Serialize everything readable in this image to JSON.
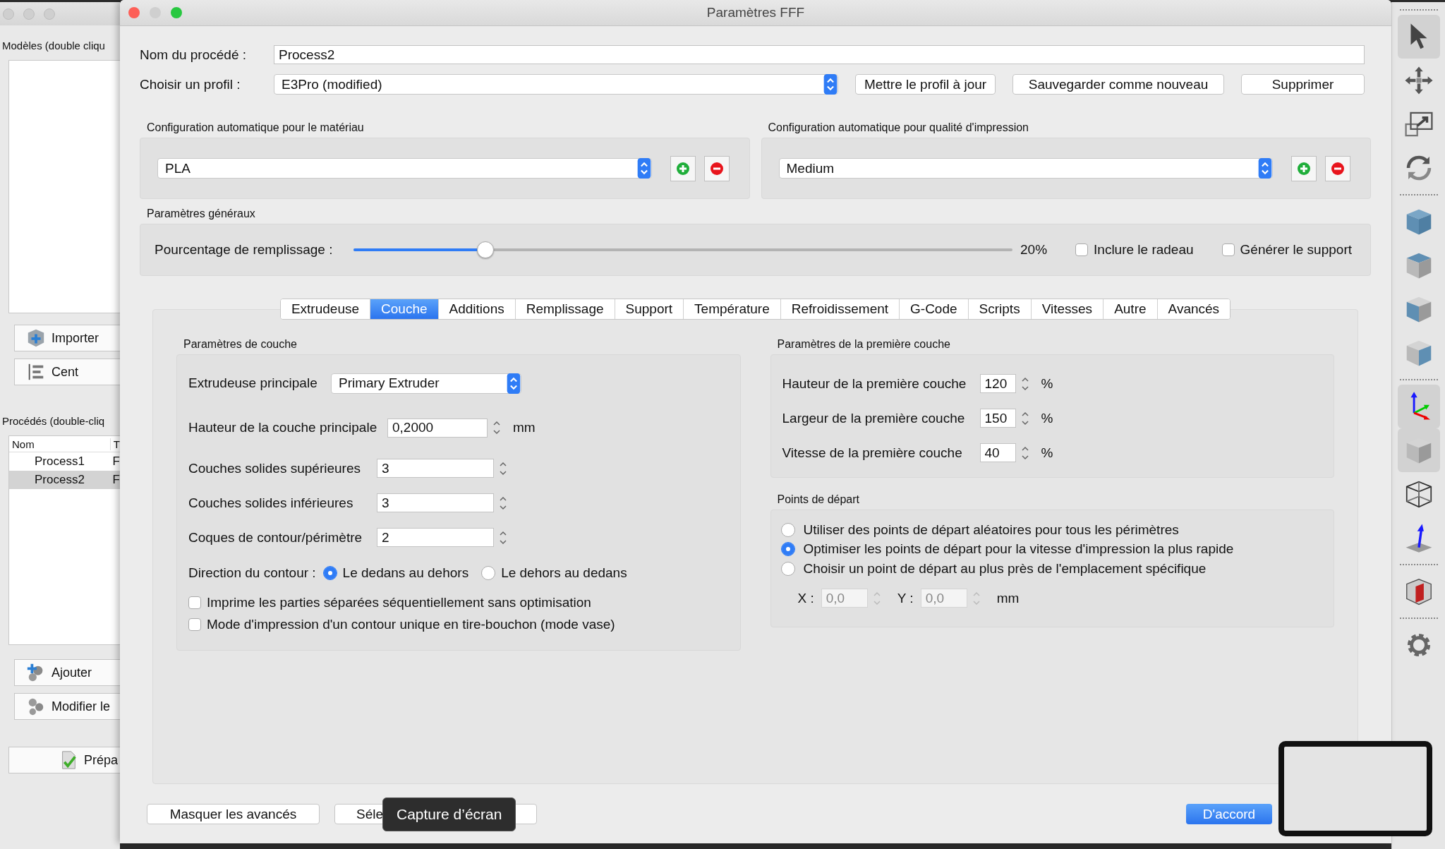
{
  "background_app": {
    "models_label": "Modèles (double cliqu",
    "top_buttons": [
      {
        "label": "Importer",
        "kind": "import"
      },
      {
        "label": "Cent",
        "kind": "center"
      }
    ],
    "processes_label": "Procédés (double-cliq",
    "table": {
      "columns": [
        "Nom",
        "T"
      ],
      "rows": [
        {
          "cells": [
            "Process1",
            "F"
          ],
          "selected": false
        },
        {
          "cells": [
            "Process2",
            "F"
          ],
          "selected": true
        }
      ]
    },
    "bottom_buttons": [
      {
        "label": "Ajouter",
        "kind": "add"
      },
      {
        "label": "Modifier le",
        "kind": "edit"
      }
    ],
    "prepare_button": {
      "label": "Prépa",
      "kind": "prepare"
    }
  },
  "window": {
    "title": "Paramètres FFF"
  },
  "process_name": {
    "label": "Nom du procédé :",
    "value": "Process2"
  },
  "profile": {
    "label": "Choisir un profil :",
    "value": "E3Pro (modified)",
    "buttons": [
      "Mettre le profil à jour",
      "Sauvegarder comme nouveau",
      "Supprimer"
    ]
  },
  "auto_config": [
    {
      "title": "Configuration automatique pour le matériau",
      "value": "PLA"
    },
    {
      "title": "Configuration automatique pour qualité d'impression",
      "value": "Medium"
    }
  ],
  "general": {
    "title": "Paramètres généraux",
    "infill_label": "Pourcentage de remplissage :",
    "level": 0.2,
    "reading": "20%",
    "options": [
      {
        "label": "Inclure le radeau",
        "checked": false
      },
      {
        "label": "Générer le support",
        "checked": false
      }
    ]
  },
  "tabs": [
    {
      "label": "Extrudeuse",
      "selected": false
    },
    {
      "label": "Couche",
      "selected": true
    },
    {
      "label": "Additions",
      "selected": false
    },
    {
      "label": "Remplissage",
      "selected": false
    },
    {
      "label": "Support",
      "selected": false
    },
    {
      "label": "Température",
      "selected": false
    },
    {
      "label": "Refroidissement",
      "selected": false
    },
    {
      "label": "G-Code",
      "selected": false
    },
    {
      "label": "Scripts",
      "selected": false
    },
    {
      "label": "Vitesses",
      "selected": false
    },
    {
      "label": "Autre",
      "selected": false
    },
    {
      "label": "Avancés",
      "selected": false
    }
  ],
  "layer": {
    "title": "Paramètres de couche",
    "main_extruder": {
      "label": "Extrudeuse principale",
      "value": "Primary Extruder"
    },
    "layer_height": {
      "label": "Hauteur de la couche principale",
      "value": "0,2000",
      "unit": "mm"
    },
    "fields": [
      {
        "label": "Couches solides supérieures",
        "value": "3"
      },
      {
        "label": "Couches solides inférieures",
        "value": "3"
      },
      {
        "label": "Coques de contour/périmètre",
        "value": "2"
      }
    ],
    "direction": {
      "label": "Direction du contour :",
      "options": [
        {
          "label": "Le dedans au dehors",
          "selected": true
        },
        {
          "label": "Le dehors au dedans",
          "selected": false
        }
      ]
    },
    "checkboxes": [
      {
        "label": "Imprime les parties séparées séquentiellement sans optimisation",
        "checked": false
      },
      {
        "label": "Mode d'impression d'un contour unique en tire-bouchon (mode vase)",
        "checked": false
      }
    ]
  },
  "first_layer": {
    "title": "Paramètres de la première couche",
    "fields": [
      {
        "label": "Hauteur de la première couche",
        "value": "120",
        "unit": "%"
      },
      {
        "label": "Largeur de la première couche",
        "value": "150",
        "unit": "%"
      },
      {
        "label": "Vitesse de la première couche",
        "value": "40",
        "unit": "%"
      }
    ]
  },
  "start_points": {
    "title": "Points de départ",
    "options": [
      {
        "label": "Utiliser des points de départ aléatoires pour tous les périmètres",
        "selected": false
      },
      {
        "label": "Optimiser les points de départ pour la vitesse d'impression la plus rapide",
        "selected": true
      },
      {
        "label": "Choisir un point de départ au plus près de l'emplacement spécifique",
        "selected": false
      }
    ],
    "coords": [
      {
        "label": "X :",
        "value": "0,0",
        "disabled": true
      },
      {
        "label": "Y :",
        "value": "0,0",
        "disabled": true
      }
    ],
    "unit": "mm"
  },
  "footer": {
    "buttons": [
      "Masquer les avancés",
      "Séle"
    ],
    "ok": "D'accord"
  },
  "tooltip": "Capture d’écran",
  "toolbar_groups": [
    {
      "items": [
        {
          "kind": "select",
          "selected": true
        },
        {
          "kind": "move",
          "selected": false
        },
        {
          "kind": "scale",
          "selected": false
        },
        {
          "kind": "rotate",
          "selected": false
        }
      ]
    },
    {
      "items": [
        {
          "kind": "view-iso",
          "selected": false
        },
        {
          "kind": "view-top",
          "selected": false
        },
        {
          "kind": "view-front",
          "selected": false
        },
        {
          "kind": "view-side",
          "selected": false
        }
      ]
    },
    {
      "items": [
        {
          "kind": "axes",
          "selected": true
        },
        {
          "kind": "solid",
          "selected": true
        },
        {
          "kind": "wireframe",
          "selected": false
        },
        {
          "kind": "normal",
          "selected": false
        }
      ]
    },
    {
      "items": [
        {
          "kind": "section",
          "selected": false
        }
      ]
    },
    {
      "items": [
        {
          "kind": "settings",
          "selected": false
        }
      ]
    }
  ]
}
